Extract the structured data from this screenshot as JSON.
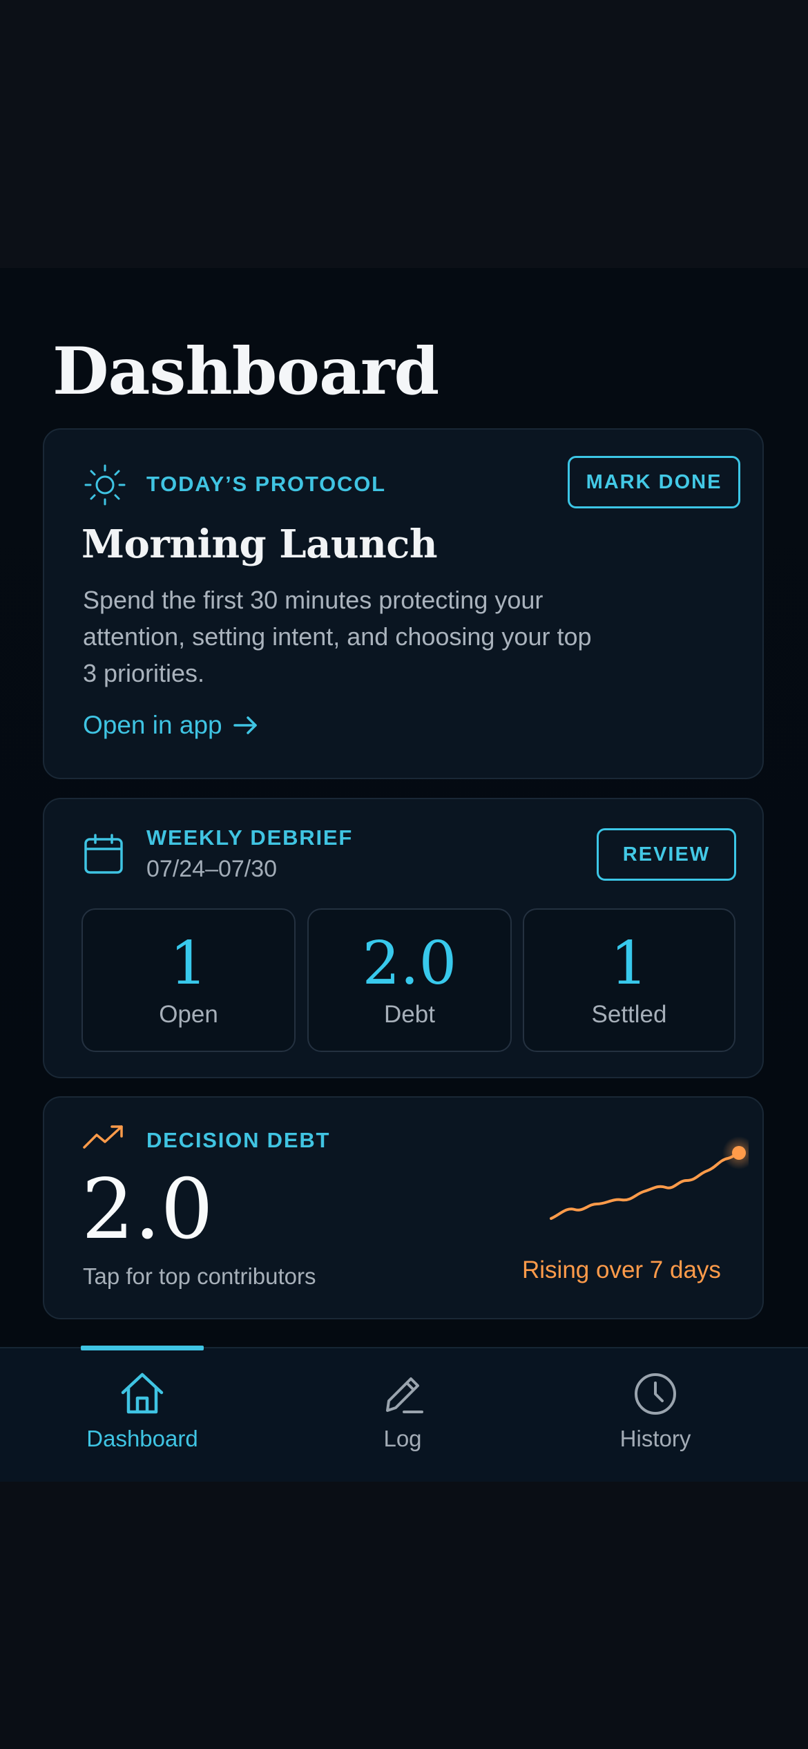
{
  "page": {
    "title": "Dashboard"
  },
  "protocol_card": {
    "eyebrow": "TODAY’S PROTOCOL",
    "action_label": "MARK DONE",
    "title": "Morning Launch",
    "description": "Spend the first 30 minutes protecting your attention, setting intent, and choosing your top 3 priorities.",
    "link_label": "Open in app",
    "icon": "sun-icon"
  },
  "debrief_card": {
    "eyebrow": "WEEKLY DEBRIEF",
    "date_range": "07/24–07/30",
    "action_label": "REVIEW",
    "icon": "calendar-icon",
    "stats": [
      {
        "value": "1",
        "label": "Open"
      },
      {
        "value": "2.0",
        "label": "Debt"
      },
      {
        "value": "1",
        "label": "Settled"
      }
    ]
  },
  "debt_card": {
    "eyebrow": "DECISION DEBT",
    "value": "2.0",
    "hint": "Tap for top contributors",
    "trend_caption": "Rising over 7 days",
    "icon": "trending-up-icon"
  },
  "bottom_nav": {
    "items": [
      {
        "label": "Dashboard",
        "icon": "home-icon",
        "active": true
      },
      {
        "label": "Log",
        "icon": "pencil-icon",
        "active": false
      },
      {
        "label": "History",
        "icon": "clock-icon",
        "active": false
      }
    ]
  },
  "colors": {
    "accent": "#3fc4e3",
    "trend": "#ff9b4a",
    "background": "#050b12",
    "card": "#0a1521"
  }
}
